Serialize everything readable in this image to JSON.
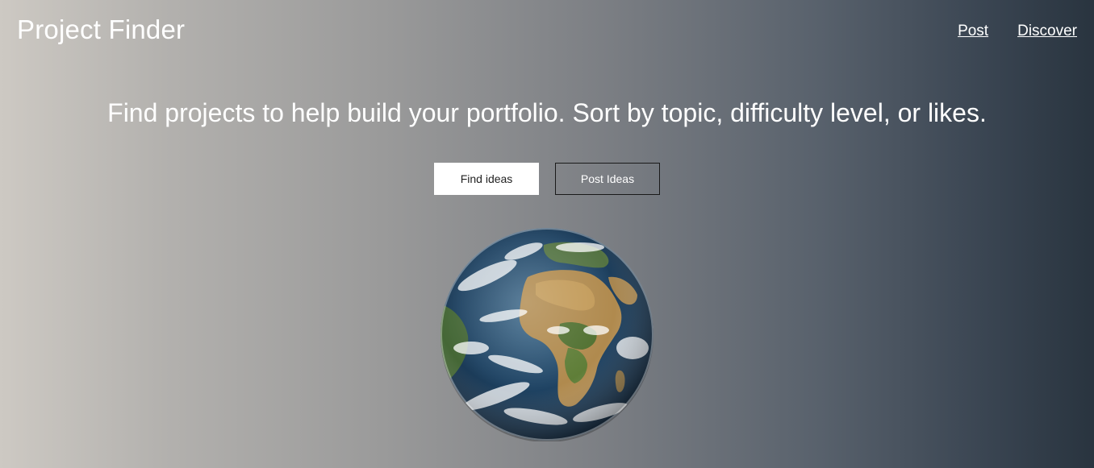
{
  "header": {
    "brand": "Project Finder",
    "nav": [
      {
        "label": "Post"
      },
      {
        "label": "Discover"
      }
    ]
  },
  "hero": {
    "tagline": "Find projects to help build your portfolio. Sort by topic, difficulty level, or likes.",
    "buttons": {
      "find_label": "Find ideas",
      "post_label": "Post Ideas"
    }
  },
  "image": {
    "icon": "earth-globe"
  }
}
